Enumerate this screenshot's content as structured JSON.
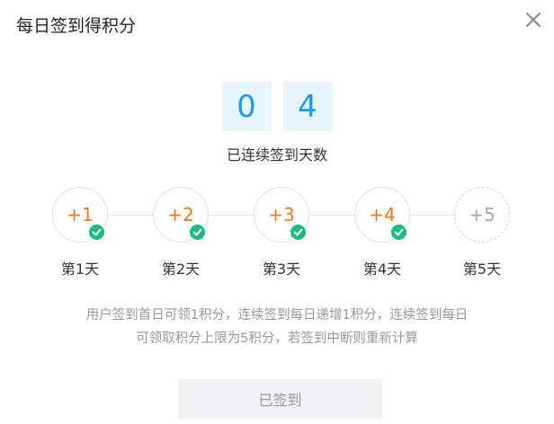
{
  "dialog": {
    "title": "每日签到得积分",
    "close_icon": "close-icon"
  },
  "streak": {
    "digits": [
      "0",
      "4"
    ],
    "label": "已连续签到天数"
  },
  "days": [
    {
      "points": "+1",
      "label": "第1天",
      "signed": true
    },
    {
      "points": "+2",
      "label": "第2天",
      "signed": true
    },
    {
      "points": "+3",
      "label": "第3天",
      "signed": true
    },
    {
      "points": "+4",
      "label": "第4天",
      "signed": true
    },
    {
      "points": "+5",
      "label": "第5天",
      "signed": false
    }
  ],
  "rules": {
    "line1": "用户签到首日可领1积分，连续签到每日递增1积分，连续签到每日",
    "line2": "可领取积分上限为5积分，若签到中断则重新计算"
  },
  "button": {
    "label": "已签到"
  },
  "colors": {
    "digit_text": "#1a9bf0",
    "digit_bg": "#e8f4ff",
    "points_earned": "#f07a1a",
    "check_bg": "#1eb980"
  }
}
